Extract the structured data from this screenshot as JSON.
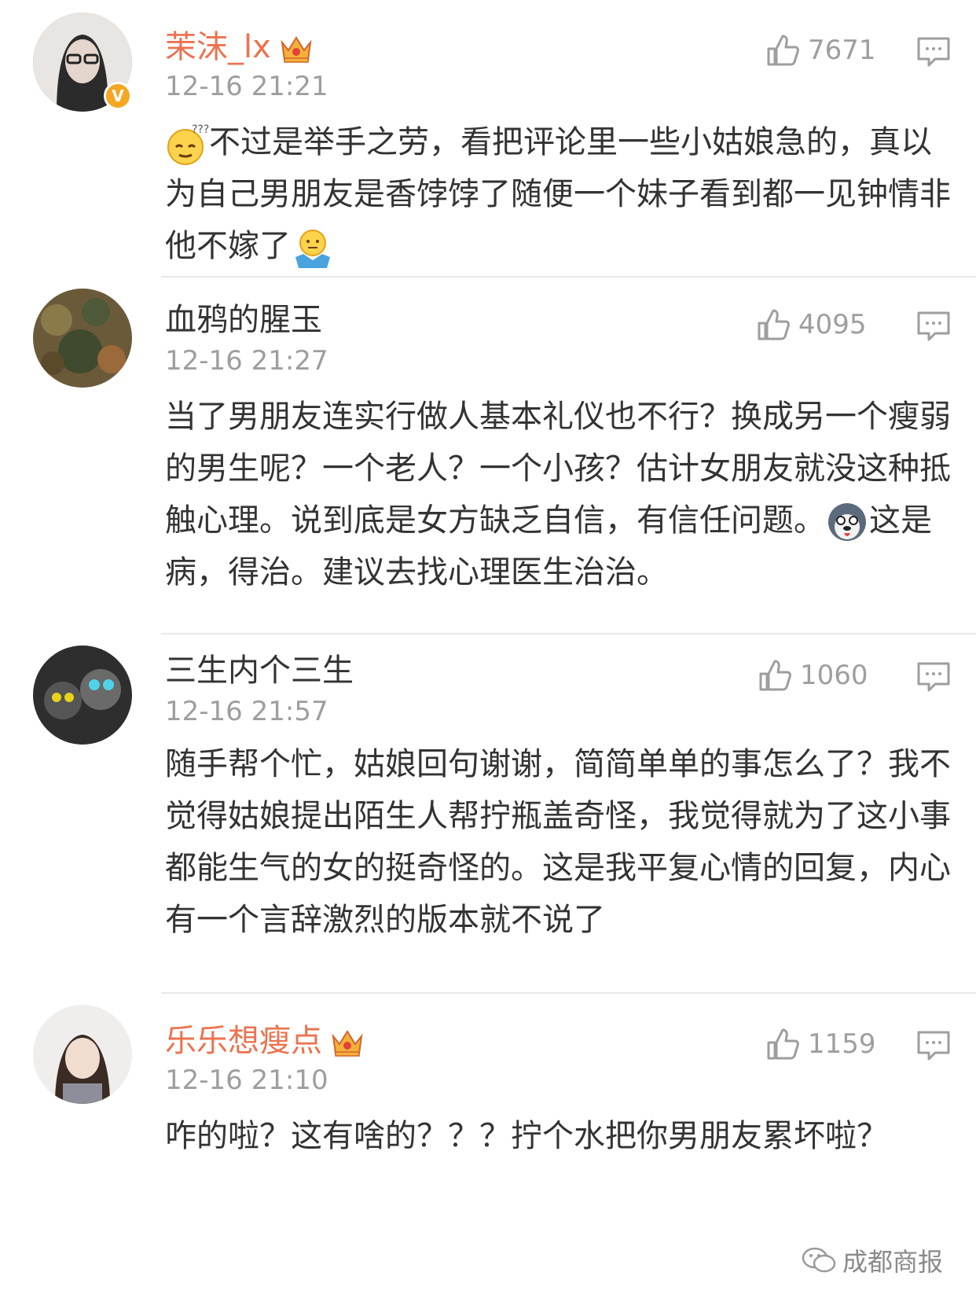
{
  "comments": [
    {
      "username": "茉沫_lx",
      "time": "12-16 21:21",
      "likes": "7671",
      "text_part1": "不过是举手之劳，看把评论里一些小姑娘急的，真以为自己男朋友是香饽饽了随便一个妹子看到都一见钟情非他不嫁了",
      "emoji_start": "thinking-emoji",
      "emoji_end": "shrug-emoji",
      "vip": true,
      "verified_badge": "V"
    },
    {
      "username": "血鸦的腥玉",
      "time": "12-16 21:27",
      "likes": "4095",
      "text_part1": "当了男朋友连实行做人基本礼仪也不行？换成另一个瘦弱的男生呢？一个老人？一个小孩？估计女朋友就没这种抵触心理。说到底是女方缺乏自信，有信任问题。",
      "text_part2": "这是病，得治。建议去找心理医生治治。",
      "emoji_mid": "husky-emoji",
      "vip": false
    },
    {
      "username": "三生内个三生",
      "time": "12-16 21:57",
      "likes": "1060",
      "text_part1": "随手帮个忙，姑娘回句谢谢，简简单单的事怎么了？我不觉得姑娘提出陌生人帮拧瓶盖奇怪，我觉得就为了这小事都能生气的女的挺奇怪的。这是我平复心情的回复，内心有一个言辞激烈的版本就不说了",
      "vip": false
    },
    {
      "username": "乐乐想瘦点",
      "time": "12-16 21:10",
      "likes": "1159",
      "text_part1": "咋的啦？这有啥的？？？拧个水把你男朋友累坏啦？",
      "vip": true
    }
  ],
  "watermark": "成都商报",
  "colors": {
    "vip_name": "#eb7350",
    "meta_gray": "#9e9e9e",
    "text": "#333333",
    "divider": "#e8e8e8"
  }
}
